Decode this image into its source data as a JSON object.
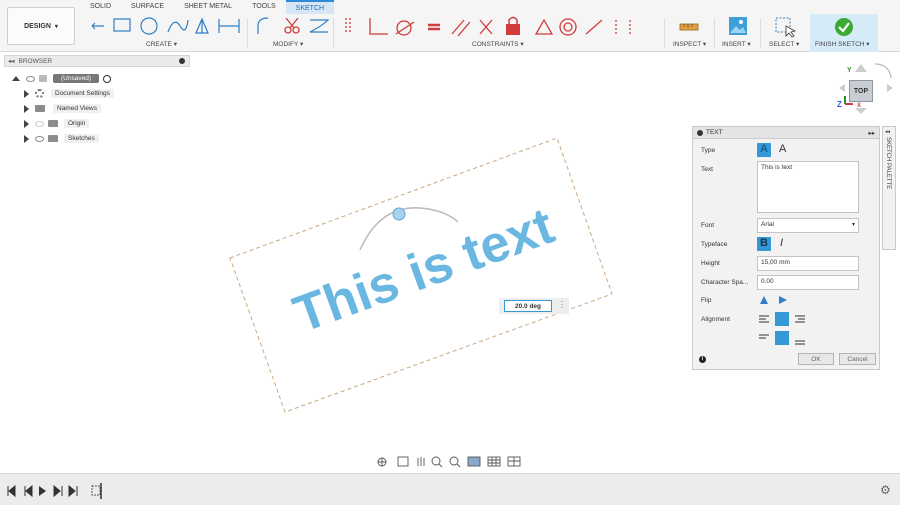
{
  "workspace_button": "DESIGN",
  "tabs": [
    "SOLID",
    "SURFACE",
    "SHEET METAL",
    "TOOLS",
    "SKETCH"
  ],
  "active_tab": "SKETCH",
  "toolbar_groups": {
    "create": "CREATE",
    "modify": "MODIFY",
    "constraints": "CONSTRAINTS",
    "inspect": "INSPECT",
    "insert": "INSERT",
    "select": "SELECT",
    "finish_sketch": "FINISH SKETCH"
  },
  "browser": {
    "title": "BROWSER",
    "root": "(Unsaved)",
    "items": [
      {
        "label": "Document Settings",
        "icon": "gear-icon"
      },
      {
        "label": "Named Views",
        "icon": "folder-icon"
      },
      {
        "label": "Origin",
        "icon": "folder-icon"
      },
      {
        "label": "Sketches",
        "icon": "folder-icon"
      }
    ]
  },
  "viewcube": {
    "face": "TOP",
    "axis_x": "X",
    "axis_y": "Y",
    "axis_z": "Z"
  },
  "sketch_text": "This is text",
  "angle_input": "20.0 deg",
  "dialog": {
    "title": "TEXT",
    "labels": {
      "type": "Type",
      "text": "Text",
      "font": "Font",
      "typeface": "Typeface",
      "height": "Height",
      "char_spacing": "Character Spa...",
      "flip": "Flip",
      "alignment": "Alignment"
    },
    "text_value": "This is text",
    "font_value": "Arial",
    "height_value": "15,00 mm",
    "char_spacing_value": "0.00",
    "ok": "OK",
    "cancel": "Cancel"
  },
  "sketch_palette_label": "SKETCH PALETTE",
  "colors": {
    "accent": "#3498d6",
    "text_blue": "#6ab8e2",
    "dashed_box": "#c8a880",
    "constraint_red": "#d23b3b"
  }
}
